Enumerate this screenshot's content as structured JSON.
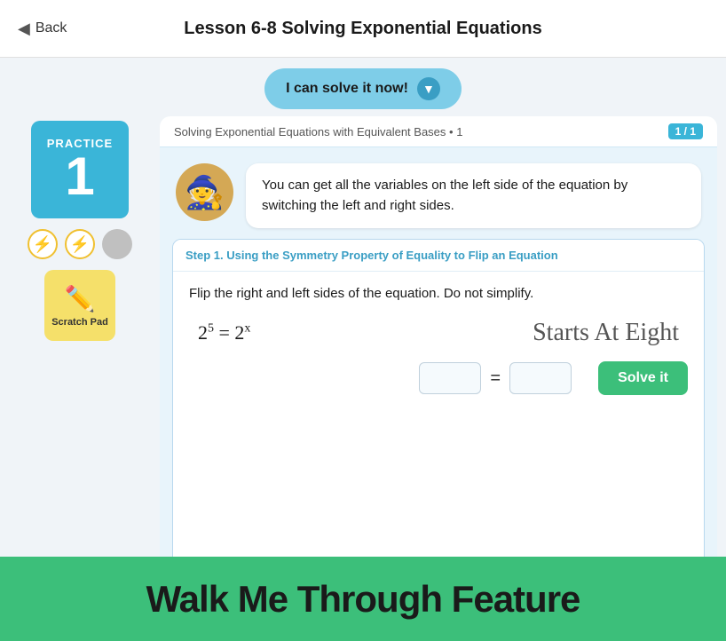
{
  "header": {
    "back_label": "Back",
    "title": "Lesson 6-8 Solving Exponential Equations"
  },
  "solve_banner": {
    "label": "I can solve it now!",
    "chevron": "▼"
  },
  "sidebar": {
    "practice_label": "PRACTICE",
    "practice_number": "1",
    "bolt1": "⚡",
    "bolt2": "⚡",
    "scratch_pad_label": "Scratch Pad",
    "scratch_pad_icon": "✏️"
  },
  "subtitle": {
    "text": "Solving Exponential Equations with Equivalent Bases • 1",
    "progress": "1 / 1"
  },
  "character": {
    "speech": "You can get all the variables on the left side of the equation by switching the left and right sides."
  },
  "step": {
    "header": "Step 1. Using the Symmetry Property of Equality to Flip an Equation",
    "instruction": "Flip the right and left sides of the equation. Do not simplify.",
    "equation_left": "2",
    "equation_exp_left": "5",
    "equation_right": "2",
    "equation_exp_right": "x",
    "watermark": "Starts At Eight"
  },
  "solve_button": {
    "label": "Solve it"
  },
  "walk_banner": {
    "text": "Walk Me Through Feature"
  }
}
